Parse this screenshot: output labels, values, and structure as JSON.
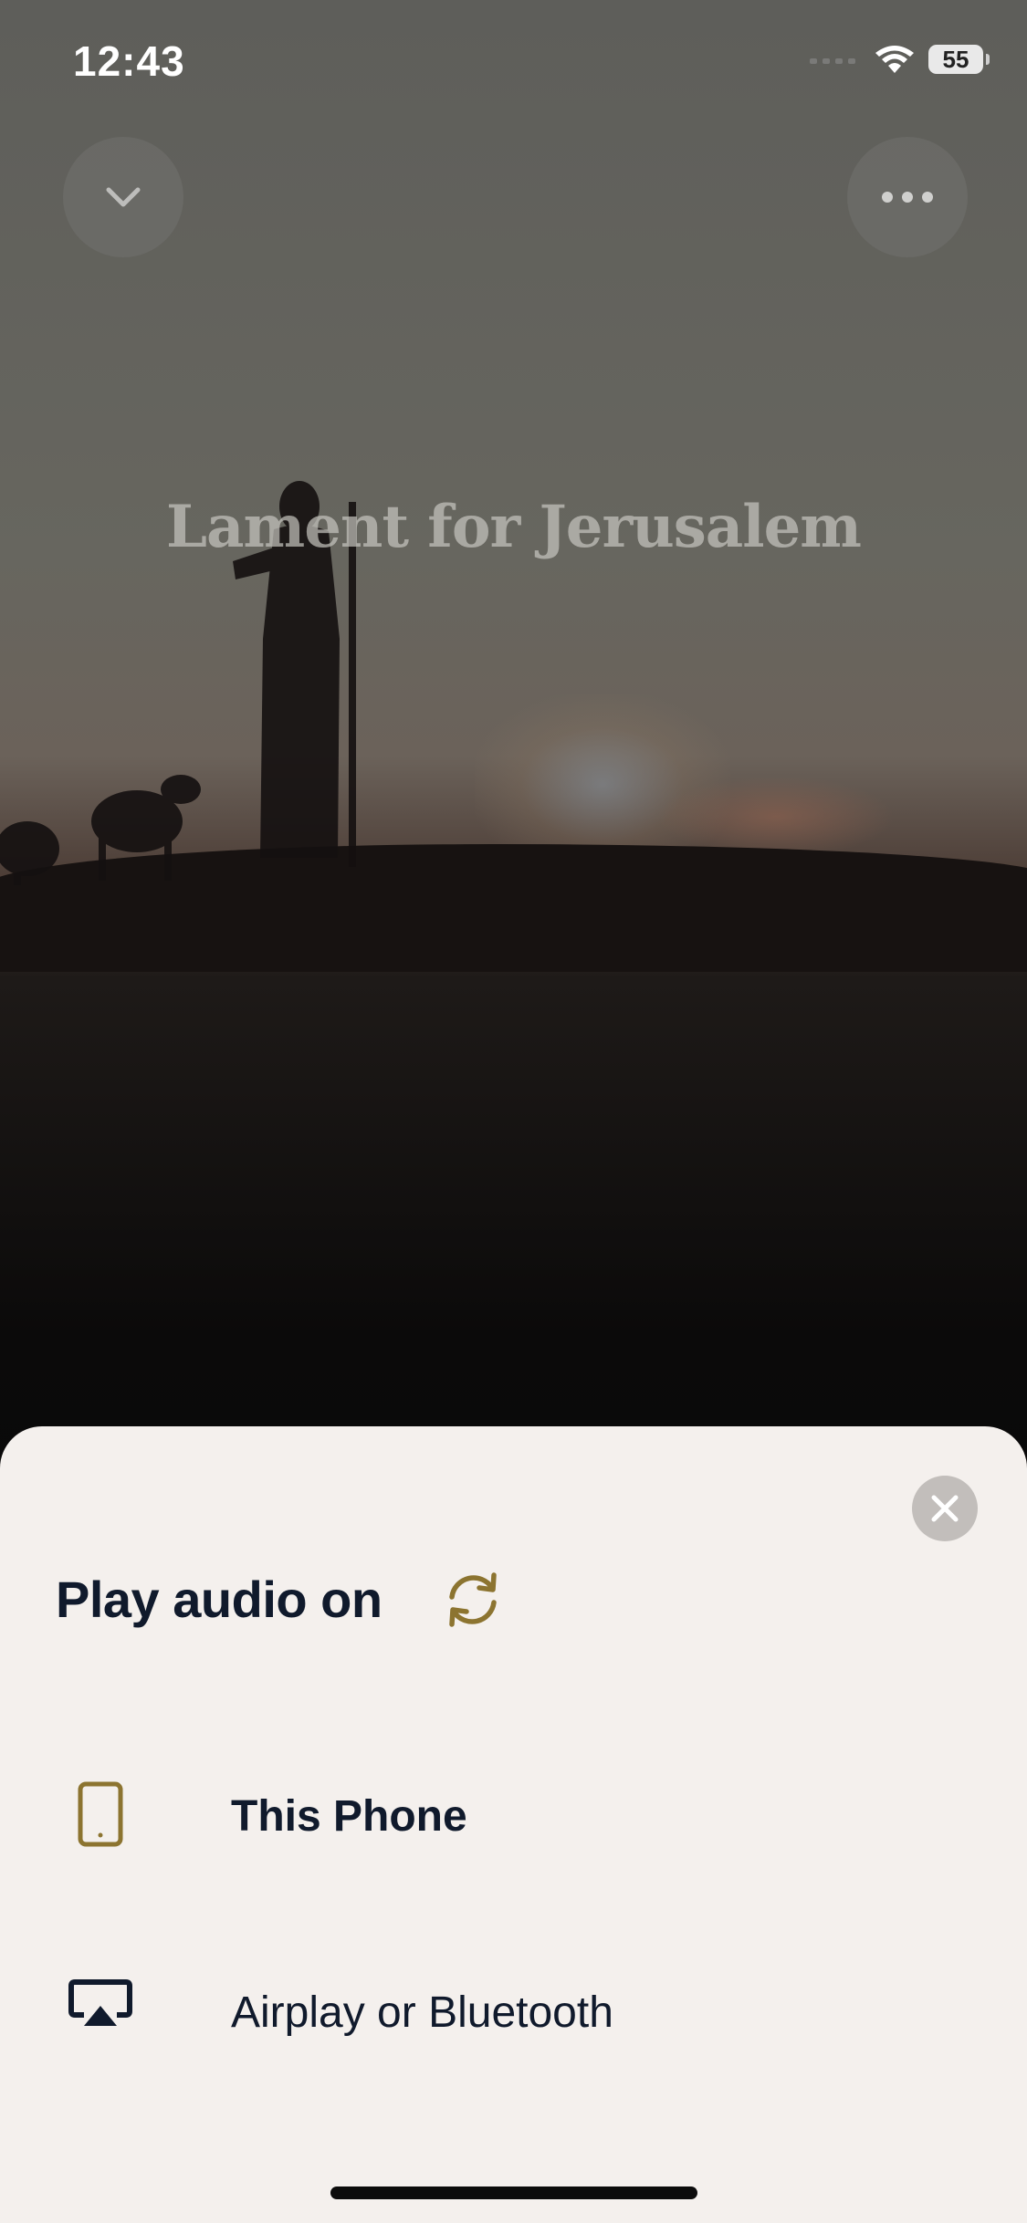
{
  "status_bar": {
    "time": "12:43",
    "battery": "55"
  },
  "player": {
    "episode_title": "Lament for Jerusalem",
    "collapse_icon": "chevron-down-icon",
    "more_icon": "ellipsis-icon"
  },
  "sheet": {
    "title": "Play audio on",
    "refresh_icon": "refresh-icon",
    "close_icon": "close-icon",
    "accent_color": "#8c7430",
    "options": [
      {
        "label": "This Phone",
        "icon": "phone-icon",
        "selected": true
      },
      {
        "label": "Airplay or Bluetooth",
        "icon": "airplay-icon",
        "selected": false
      }
    ]
  }
}
